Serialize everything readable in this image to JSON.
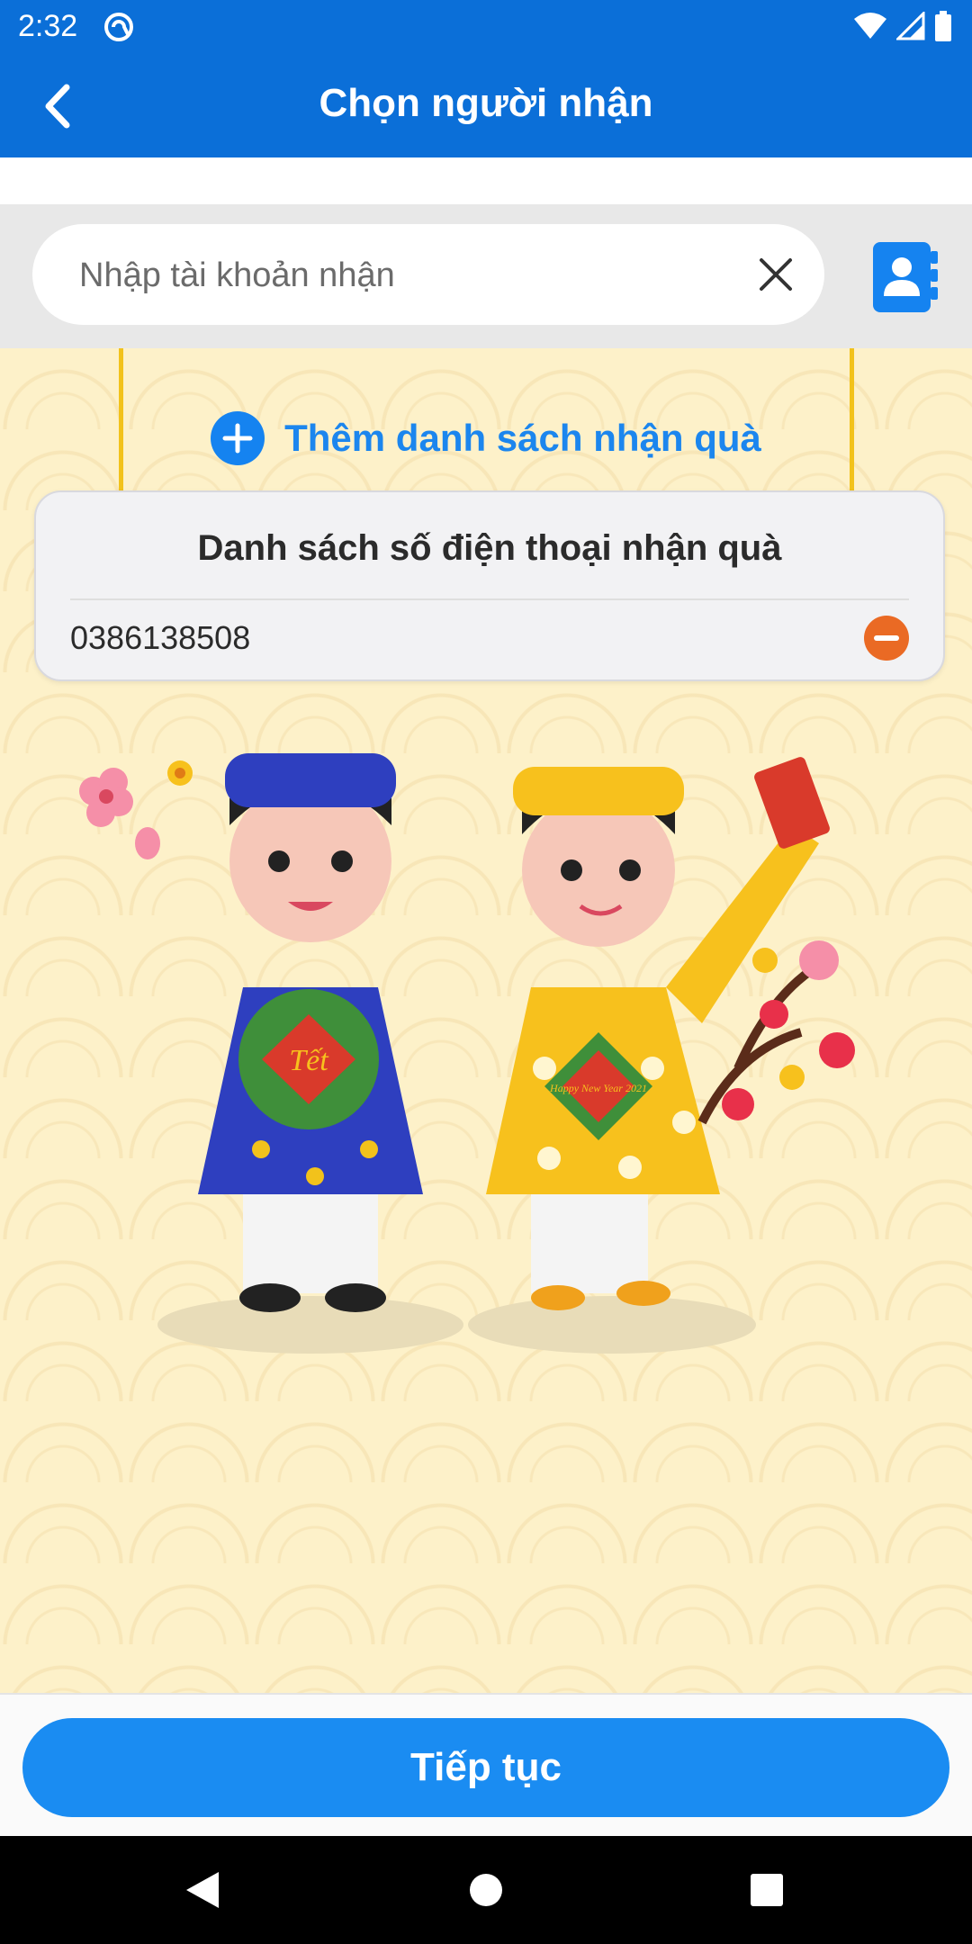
{
  "status_bar": {
    "time": "2:32"
  },
  "header": {
    "title": "Chọn người nhận",
    "back_icon": "chevron-left-icon"
  },
  "search": {
    "placeholder": "Nhập tài khoản nhận",
    "value": "",
    "clear_icon": "close-icon",
    "contacts_icon": "contacts-book-icon"
  },
  "gift_list": {
    "add_label": "Thêm danh sách nhận quà",
    "title": "Danh sách số điện thoại nhận quà",
    "items": [
      {
        "phone": "0386138508"
      }
    ]
  },
  "footer": {
    "continue_label": "Tiếp tục"
  },
  "illustration": {
    "watermelon_text": "Tết",
    "card_text": "Happy New Year 2021"
  },
  "colors": {
    "primary": "#0b6fd8",
    "accent": "#1a8cf2",
    "remove": "#ea6a24",
    "background": "#fdf1c9"
  }
}
